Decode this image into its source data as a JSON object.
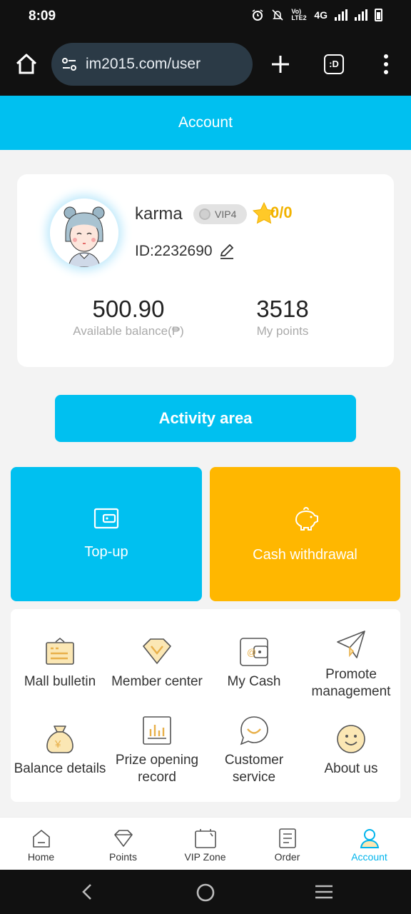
{
  "status_bar": {
    "time": "8:09",
    "network": "4G",
    "volte": "Vo) LTE2"
  },
  "browser": {
    "url": "im2015.com/user",
    "tab_count": ":D"
  },
  "header": {
    "title": "Account"
  },
  "profile": {
    "username": "karma",
    "vip_level": "VIP4",
    "stars": "0/0",
    "id": "ID:2232690",
    "balance_value": "500.90",
    "balance_label": "Available balance(₱)",
    "points_value": "3518",
    "points_label": "My points"
  },
  "activity_button": {
    "label": "Activity area"
  },
  "tiles": {
    "topup": "Top-up",
    "cash_withdrawal": "Cash withdrawal"
  },
  "grid": {
    "items": [
      {
        "label": "Mall bulletin",
        "icon": "bulletin-icon"
      },
      {
        "label": "Member center",
        "icon": "diamond-icon"
      },
      {
        "label": "My Cash",
        "icon": "wallet-icon"
      },
      {
        "label": "Promote management",
        "icon": "paper-plane-icon"
      },
      {
        "label": "Balance details",
        "icon": "money-bag-icon"
      },
      {
        "label": "Prize opening record",
        "icon": "bar-chart-icon"
      },
      {
        "label": "Customer service",
        "icon": "chat-smile-icon"
      },
      {
        "label": "About us",
        "icon": "smiley-icon"
      }
    ]
  },
  "bottom_nav": {
    "items": [
      {
        "label": "Home",
        "icon": "home-icon"
      },
      {
        "label": "Points",
        "icon": "gem-icon"
      },
      {
        "label": "VIP Zone",
        "icon": "vip-icon"
      },
      {
        "label": "Order",
        "icon": "order-icon"
      },
      {
        "label": "Account",
        "icon": "account-icon"
      }
    ],
    "active": "Account"
  },
  "colors": {
    "primary": "#00c0f0",
    "accent": "#ffb700",
    "grid_icon": "#e8b04a"
  }
}
